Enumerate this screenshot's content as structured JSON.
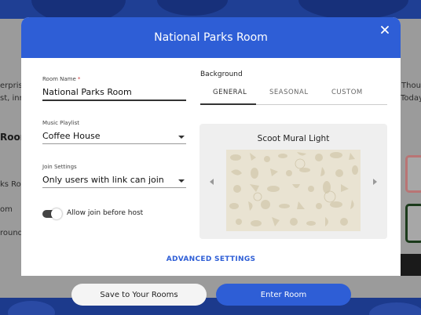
{
  "background_page": {
    "left_snippets": [
      "erprise",
      "st, inn",
      "Room",
      "ks Room",
      "om",
      "round"
    ],
    "right_snippets": [
      "Thou",
      "Today"
    ]
  },
  "modal": {
    "title": "National Parks Room",
    "close_icon": "close-icon",
    "room_name": {
      "label": "Room Name",
      "required_mark": "*",
      "value": "National Parks Room"
    },
    "music_playlist": {
      "label": "Music Playlist",
      "value": "Coffee House"
    },
    "join_settings": {
      "label": "Join Settings",
      "value": "Only users with link can join"
    },
    "allow_join": {
      "label": "Allow join before host",
      "enabled": true
    },
    "background": {
      "heading": "Background",
      "tabs": [
        {
          "label": "GENERAL",
          "active": true
        },
        {
          "label": "SEASONAL",
          "active": false
        },
        {
          "label": "CUSTOM",
          "active": false
        }
      ],
      "preview_title": "Scoot Mural Light",
      "prev_icon": "chevron-left-icon",
      "next_icon": "chevron-right-icon"
    },
    "advanced_settings_label": "ADVANCED SETTINGS"
  },
  "actions": {
    "save_label": "Save to Your Rooms",
    "enter_label": "Enter Room"
  },
  "colors": {
    "accent": "#2e5ed6",
    "backdrop_navy": "#1f3f94"
  }
}
